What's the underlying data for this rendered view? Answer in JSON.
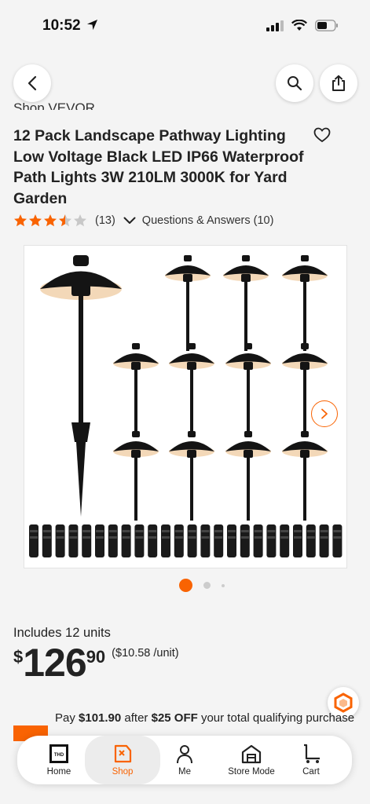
{
  "status_bar": {
    "time": "10:52"
  },
  "product": {
    "brand_link": "Shop VEVOR",
    "title": "12 Pack Landscape Pathway Lighting Low Voltage Black LED IP66 Waterproof Path Lights 3W 210LM 3000K for Yard Garden",
    "rating_value": 3.5,
    "review_count": "(13)",
    "qa_label": "Questions & Answers (10)",
    "includes": "Includes 12 units",
    "price_currency": "$",
    "price_dollars": "126",
    "price_cents": "90",
    "price_per_unit": "($10.58 /unit)",
    "image_page": 1,
    "image_pages_visible": 3
  },
  "promo": {
    "prefix": "Pay ",
    "amount": "$101.90",
    "middle": " after ",
    "discount": "$25 OFF",
    "suffix": " your total qualifying purchase"
  },
  "tabs": [
    {
      "label": "Home",
      "icon": "home-depot-logo-icon",
      "active": false
    },
    {
      "label": "Shop",
      "icon": "shop-icon",
      "active": true
    },
    {
      "label": "Me",
      "icon": "person-icon",
      "active": false
    },
    {
      "label": "Store Mode",
      "icon": "store-icon",
      "active": false
    },
    {
      "label": "Cart",
      "icon": "cart-icon",
      "active": false
    }
  ],
  "colors": {
    "accent": "#f96302",
    "star": "#f96302"
  }
}
